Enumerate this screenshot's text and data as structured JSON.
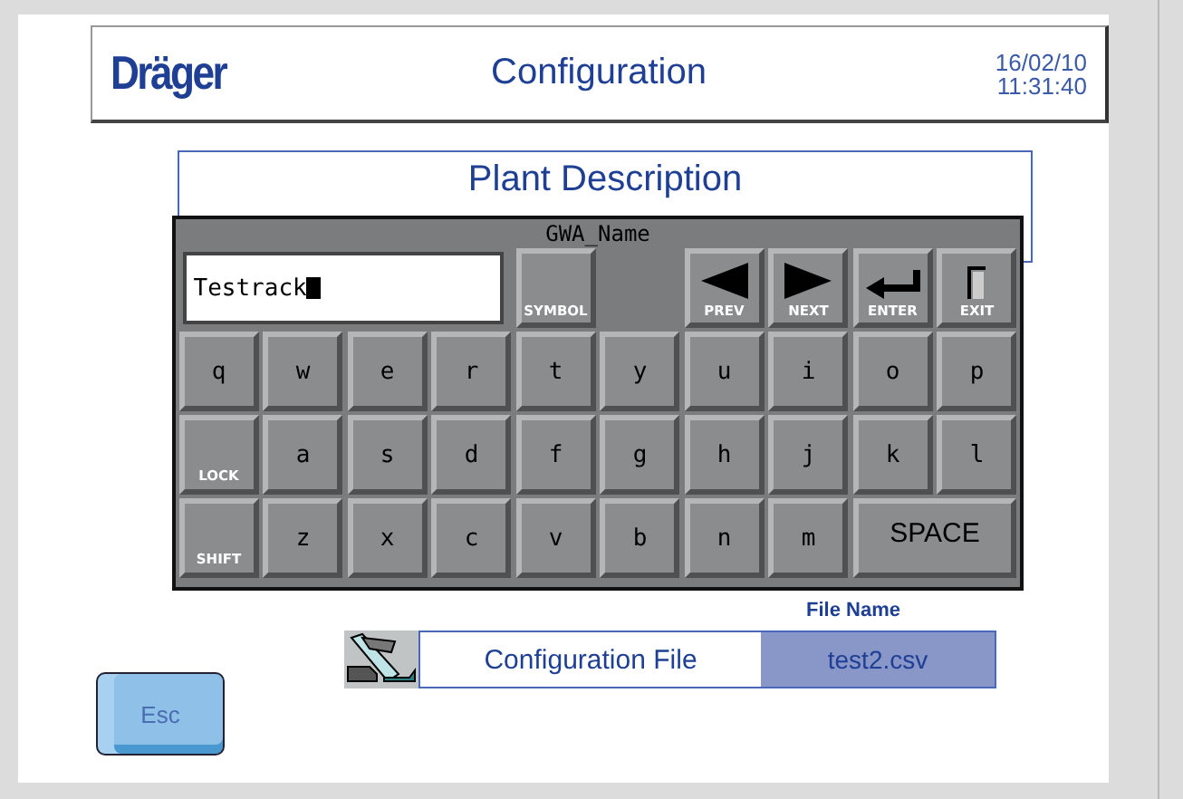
{
  "header": {
    "logo": "Dräger",
    "title": "Configuration",
    "date": "16/02/10",
    "time": "11:31:40"
  },
  "plant_description": {
    "title": "Plant Description"
  },
  "keyboard": {
    "title": "GWA_Name",
    "field": {
      "value": "Testrack"
    },
    "top_keys": [
      {
        "label": "SYMBOL",
        "kind": "text"
      },
      {
        "label": "PREV",
        "kind": "prev"
      },
      {
        "label": "NEXT",
        "kind": "next"
      },
      {
        "label": "ENTER",
        "kind": "enter"
      },
      {
        "label": "EXIT",
        "kind": "exit"
      }
    ],
    "rows": [
      [
        {
          "label": "q",
          "kind": "char"
        },
        {
          "label": "w",
          "kind": "char"
        },
        {
          "label": "e",
          "kind": "char"
        },
        {
          "label": "r",
          "kind": "char"
        },
        {
          "label": "t",
          "kind": "char"
        },
        {
          "label": "y",
          "kind": "char"
        },
        {
          "label": "u",
          "kind": "char"
        },
        {
          "label": "i",
          "kind": "char"
        },
        {
          "label": "o",
          "kind": "char"
        },
        {
          "label": "p",
          "kind": "char"
        }
      ],
      [
        {
          "label": "LOCK",
          "kind": "mod"
        },
        {
          "label": "a",
          "kind": "char"
        },
        {
          "label": "s",
          "kind": "char"
        },
        {
          "label": "d",
          "kind": "char"
        },
        {
          "label": "f",
          "kind": "char"
        },
        {
          "label": "g",
          "kind": "char"
        },
        {
          "label": "h",
          "kind": "char"
        },
        {
          "label": "j",
          "kind": "char"
        },
        {
          "label": "k",
          "kind": "char"
        },
        {
          "label": "l",
          "kind": "char"
        }
      ],
      [
        {
          "label": "SHIFT",
          "kind": "mod"
        },
        {
          "label": "z",
          "kind": "char"
        },
        {
          "label": "x",
          "kind": "char"
        },
        {
          "label": "c",
          "kind": "char"
        },
        {
          "label": "v",
          "kind": "char"
        },
        {
          "label": "b",
          "kind": "char"
        },
        {
          "label": "n",
          "kind": "char"
        },
        {
          "label": "m",
          "kind": "char"
        },
        {
          "label": "SPACE",
          "kind": "space"
        }
      ]
    ]
  },
  "file": {
    "heading": "File Name",
    "label": "Configuration File",
    "value": "test2.csv"
  },
  "esc_button": "Esc"
}
